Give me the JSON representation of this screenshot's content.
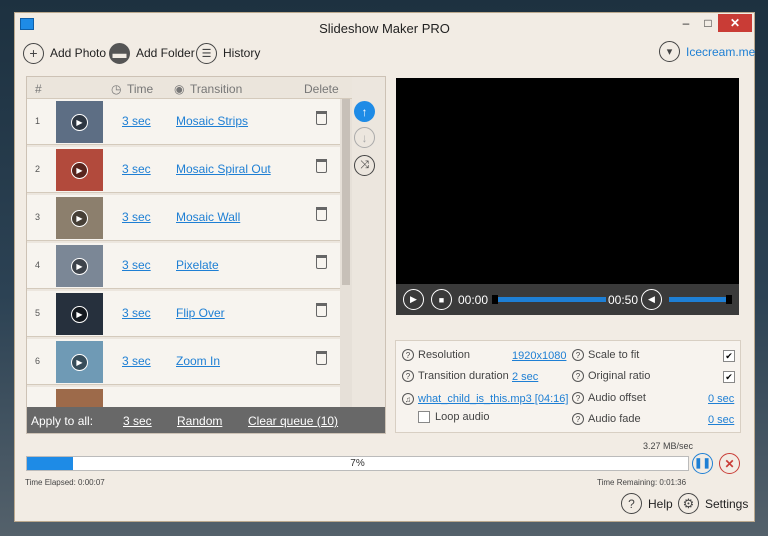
{
  "window": {
    "title": "Slideshow Maker PRO",
    "minimize": "–",
    "maximize": "□",
    "close": "✕"
  },
  "toolbar": {
    "add_photo": "Add Photo",
    "add_folder": "Add Folder",
    "history": "History",
    "icecream": "Icecream.me"
  },
  "queue": {
    "headers": {
      "num": "#",
      "time": "Time",
      "transition": "Transition",
      "delete": "Delete"
    },
    "rows": [
      {
        "num": "1",
        "time": "3 sec",
        "transition": "Mosaic Strips"
      },
      {
        "num": "2",
        "time": "3 sec",
        "transition": "Mosaic Spiral Out"
      },
      {
        "num": "3",
        "time": "3 sec",
        "transition": "Mosaic Wall"
      },
      {
        "num": "4",
        "time": "3 sec",
        "transition": "Pixelate"
      },
      {
        "num": "5",
        "time": "3 sec",
        "transition": "Flip Over"
      },
      {
        "num": "6",
        "time": "3 sec",
        "transition": "Zoom In"
      }
    ],
    "apply_all": {
      "label": "Apply to all:",
      "time": "3 sec",
      "transition": "Random",
      "clear": "Clear queue (10)"
    }
  },
  "player": {
    "current_time": "00:00",
    "total_time": "00:50"
  },
  "settings": {
    "resolution_label": "Resolution",
    "resolution_value": "1920x1080",
    "transition_duration_label": "Transition duration",
    "transition_duration_value": "2 sec",
    "audio_file": "what_child_is_this.mp3 [04:16]",
    "loop_audio": "Loop audio",
    "scale_to_fit": "Scale to fit",
    "original_ratio": "Original ratio",
    "audio_offset_label": "Audio offset",
    "audio_offset_value": "0 sec",
    "audio_fade_label": "Audio fade",
    "audio_fade_value": "0 sec"
  },
  "progress": {
    "percent": 7,
    "label": "7%",
    "speed": "3.27 MB/sec",
    "elapsed": "Time Elapsed: 0:00:07",
    "remaining": "Time Remaining: 0:01:36"
  },
  "footer": {
    "help": "Help",
    "settings": "Settings"
  },
  "colors": {
    "accent": "#1e8be6",
    "close": "#c93c36"
  }
}
